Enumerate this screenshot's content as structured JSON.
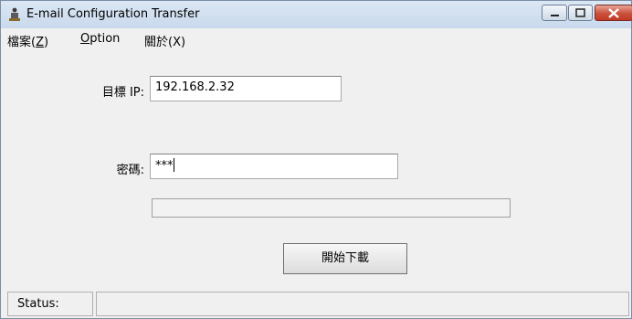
{
  "window": {
    "title": "E-mail Configuration Transfer",
    "icon": "app-person-icon"
  },
  "controls": {
    "minimize": "minimize-icon",
    "maximize": "maximize-icon",
    "close": "close-icon"
  },
  "menu": {
    "file_label": "檔案",
    "file_mnemonic": "Z",
    "option_mnemonic": "O",
    "option_rest": "ption",
    "about_label": "關於",
    "about_mnemonic": "X"
  },
  "form": {
    "ip_label": "目標 IP:",
    "ip_value": "192.168.2.32",
    "password_label": "密碼:",
    "password_value": "***",
    "progress": 0,
    "download_button": "開始下載"
  },
  "status": {
    "label": "Status:",
    "value": ""
  },
  "colors": {
    "titlebar": "#c9d9ec",
    "close": "#c43a26",
    "face": "#f0f0f0"
  }
}
